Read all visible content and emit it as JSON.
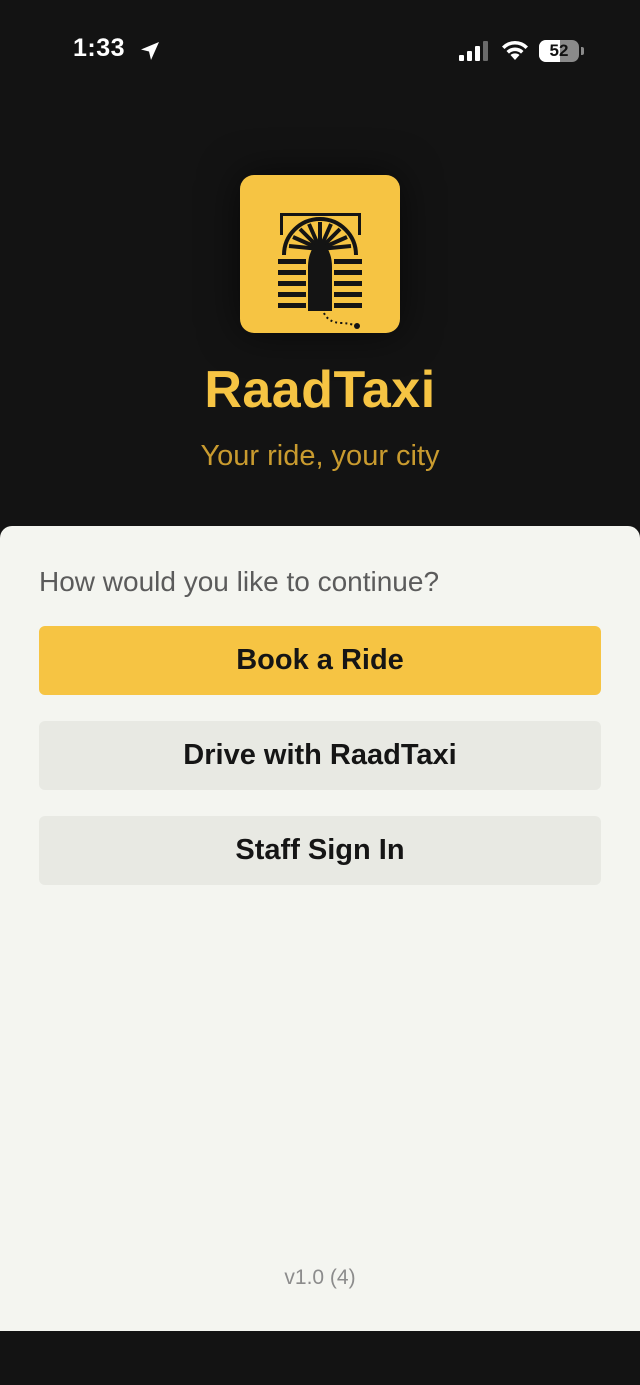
{
  "status_bar": {
    "time": "1:33",
    "battery_level": "52",
    "battery_fraction": 0.52,
    "icons": [
      "location-arrow-icon",
      "cellular-signal-icon",
      "wifi-icon",
      "battery-icon"
    ]
  },
  "brand": {
    "app_name": "RaadTaxi",
    "tagline": "Your ride, your city",
    "logo_icon": "arch-gate-logo",
    "colors": {
      "accent": "#f6c443",
      "tagline": "#c99b2f",
      "background_dark": "#131313",
      "sheet_background": "#f4f5f0"
    }
  },
  "sheet": {
    "prompt": "How would you like to continue?",
    "buttons": {
      "book_ride": "Book a Ride",
      "drive": "Drive with RaadTaxi",
      "staff": "Staff Sign In"
    },
    "version": "v1.0 (4)"
  }
}
